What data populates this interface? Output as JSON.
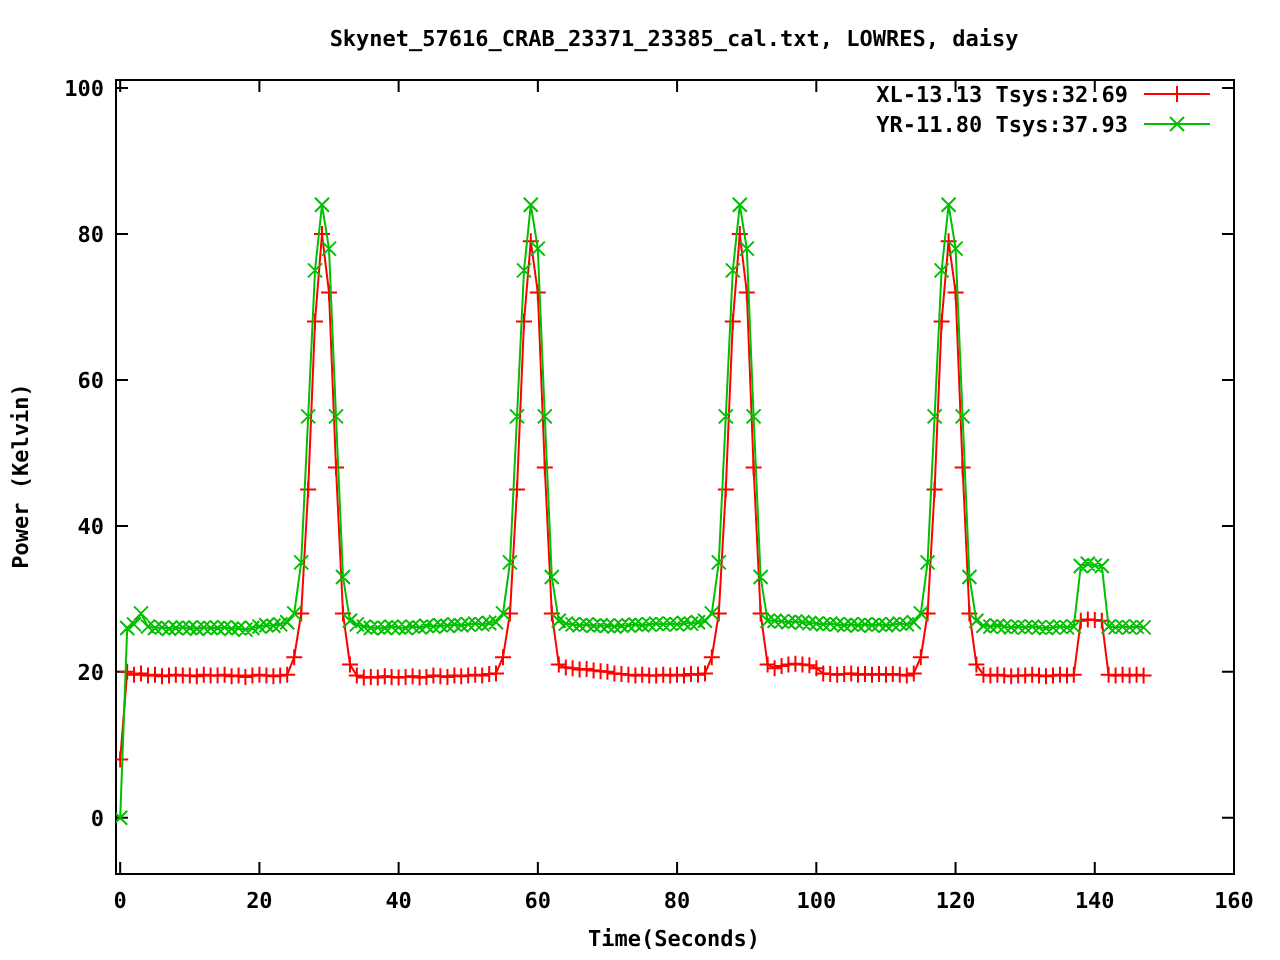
{
  "chart_data": {
    "type": "line",
    "title": "Skynet_57616_CRAB_23371_23385_cal.txt, LOWRES, daisy",
    "xlabel": "Time(Seconds)",
    "ylabel": "Power (Kelvin)",
    "xlim": [
      -0.6,
      160
    ],
    "ylim": [
      -7.7,
      101.1
    ],
    "xticks": [
      0,
      20,
      40,
      60,
      80,
      100,
      120,
      140,
      160
    ],
    "yticks": [
      0,
      20,
      40,
      60,
      80,
      100
    ],
    "legend": true,
    "x": [
      0,
      1,
      2,
      3,
      4,
      5,
      6,
      7,
      8,
      9,
      10,
      11,
      12,
      13,
      14,
      15,
      16,
      17,
      18,
      19,
      20,
      21,
      22,
      23,
      24,
      25,
      26,
      27,
      28,
      29,
      30,
      31,
      32,
      33,
      34,
      35,
      36,
      37,
      38,
      39,
      40,
      41,
      42,
      43,
      44,
      45,
      46,
      47,
      48,
      49,
      50,
      51,
      52,
      53,
      54,
      55,
      56,
      57,
      58,
      59,
      60,
      61,
      62,
      63,
      64,
      65,
      66,
      67,
      68,
      69,
      70,
      71,
      72,
      73,
      74,
      75,
      76,
      77,
      78,
      79,
      80,
      81,
      82,
      83,
      84,
      85,
      86,
      87,
      88,
      89,
      90,
      91,
      92,
      93,
      94,
      95,
      96,
      97,
      98,
      99,
      100,
      101,
      102,
      103,
      104,
      105,
      106,
      107,
      108,
      109,
      110,
      111,
      112,
      113,
      114,
      115,
      116,
      117,
      118,
      119,
      120,
      121,
      122,
      123,
      124,
      125,
      126,
      127,
      128,
      129,
      130,
      131,
      132,
      133,
      134,
      135,
      136,
      137,
      138,
      139,
      140,
      141,
      142,
      143,
      144,
      145,
      146,
      147
    ],
    "series": [
      {
        "name": "XL-13.13 Tsys:32.69",
        "color": "#ff0000",
        "marker": "plus",
        "values": [
          8,
          20,
          19.6,
          19.8,
          19.5,
          19.6,
          19.4,
          19.5,
          19.6,
          19.5,
          19.5,
          19.4,
          19.6,
          19.5,
          19.5,
          19.6,
          19.4,
          19.5,
          19.3,
          19.5,
          19.6,
          19.5,
          19.4,
          19.5,
          19.6,
          22,
          28,
          45,
          68,
          80,
          72,
          48,
          28,
          21,
          19.5,
          19.2,
          19.3,
          19.2,
          19.4,
          19.3,
          19.2,
          19.3,
          19.4,
          19.2,
          19.3,
          19.5,
          19.4,
          19.3,
          19.5,
          19.4,
          19.5,
          19.6,
          19.5,
          19.7,
          19.8,
          22,
          28,
          45,
          68,
          79,
          72,
          48,
          28,
          21,
          20.6,
          20.5,
          20.3,
          20.4,
          20.2,
          20.1,
          20,
          19.8,
          19.7,
          19.6,
          19.5,
          19.6,
          19.5,
          19.5,
          19.6,
          19.5,
          19.6,
          19.5,
          19.7,
          19.6,
          19.8,
          22,
          28,
          45,
          68,
          80,
          72,
          48,
          28,
          21,
          20.5,
          20.8,
          21,
          21.1,
          21,
          20.9,
          20.5,
          19.8,
          19.7,
          19.6,
          19.7,
          19.8,
          19.6,
          19.7,
          19.6,
          19.7,
          19.6,
          19.7,
          19.6,
          19.5,
          19.8,
          22,
          28,
          45,
          68,
          79,
          72,
          48,
          28,
          21,
          19.6,
          19.5,
          19.6,
          19.5,
          19.4,
          19.5,
          19.5,
          19.6,
          19.5,
          19.4,
          19.5,
          19.6,
          19.5,
          19.6,
          27,
          27.2,
          27.1,
          27,
          19.6,
          19.5,
          19.6,
          19.5,
          19.6,
          19.5
        ]
      },
      {
        "name": "YR-11.80 Tsys:37.93",
        "color": "#00c000",
        "marker": "cross",
        "values": [
          0,
          26,
          26.5,
          28,
          26.2,
          26,
          26.1,
          25.9,
          26,
          26.1,
          26,
          25.9,
          26.1,
          26,
          26,
          26.1,
          25.9,
          26,
          25.8,
          26,
          26.2,
          26.4,
          26.3,
          26.5,
          26.8,
          28,
          35,
          55,
          75,
          84,
          78,
          55,
          33,
          27,
          26.5,
          26.2,
          26,
          26.1,
          26,
          26.2,
          26.1,
          26,
          26.2,
          26.1,
          26.3,
          26.2,
          26.4,
          26.3,
          26.5,
          26.4,
          26.5,
          26.6,
          26.5,
          26.7,
          26.8,
          28,
          35,
          55,
          75,
          84,
          78,
          55,
          33,
          27,
          26.6,
          26.5,
          26.4,
          26.5,
          26.3,
          26.4,
          26.3,
          26.2,
          26.3,
          26.4,
          26.5,
          26.4,
          26.5,
          26.6,
          26.5,
          26.6,
          26.5,
          26.7,
          26.6,
          26.8,
          27,
          28,
          35,
          55,
          75,
          84,
          78,
          55,
          33,
          27,
          27,
          26.9,
          26.8,
          26.9,
          26.8,
          26.7,
          26.6,
          26.5,
          26.6,
          26.5,
          26.4,
          26.5,
          26.4,
          26.5,
          26.4,
          26.5,
          26.4,
          26.5,
          26.6,
          26.5,
          26.8,
          28,
          35,
          55,
          75,
          84,
          78,
          55,
          33,
          27,
          26.3,
          26.2,
          26.3,
          26.2,
          26.1,
          26.2,
          26.1,
          26.2,
          26.1,
          26,
          26.1,
          26.2,
          26.1,
          26.2,
          34.5,
          34.8,
          34.6,
          34.5,
          26.2,
          26.1,
          26.2,
          26.1,
          26.2,
          26.1
        ]
      }
    ]
  }
}
